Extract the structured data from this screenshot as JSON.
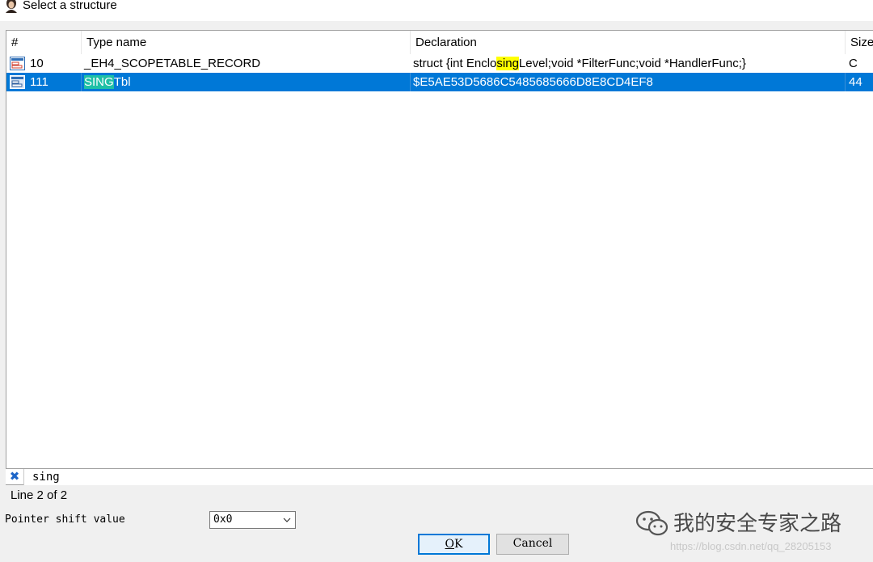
{
  "window": {
    "title": "Select a structure",
    "icon": "avatar-icon"
  },
  "table": {
    "columns": [
      "#",
      "Type name",
      "Declaration",
      "Size"
    ],
    "rows": [
      {
        "num": "10",
        "type_name": "_EH4_SCOPETABLE_RECORD",
        "decl_before": "struct {int Enclo",
        "decl_match": "sing",
        "decl_after": "Level;void *FilterFunc;void *HandlerFunc;}",
        "size": "C",
        "icon": "struct-icon",
        "selected": false
      },
      {
        "num": "111",
        "type_match": "SING",
        "type_after": "Tbl",
        "declaration": "$E5AE53D5686C5485685666D8E8CD4EF8",
        "size": "44",
        "icon": "struct-icon",
        "selected": true
      }
    ]
  },
  "search": {
    "value": "sing",
    "clear_icon": "clear-x-icon"
  },
  "status": "Line 2 of 2",
  "pointer_shift": {
    "label": "Pointer shift value",
    "value": "0x0"
  },
  "buttons": {
    "ok_mnemonic": "O",
    "ok_rest": "K",
    "cancel": "Cancel"
  },
  "watermark": {
    "text": "我的安全专家之路",
    "url": "https://blog.csdn.net/qq_28205153",
    "icon": "wechat-icon"
  },
  "colors": {
    "selection": "#0078d7",
    "match_highlight": "#ffff00",
    "selected_match_highlight": "#1fc0a6"
  }
}
